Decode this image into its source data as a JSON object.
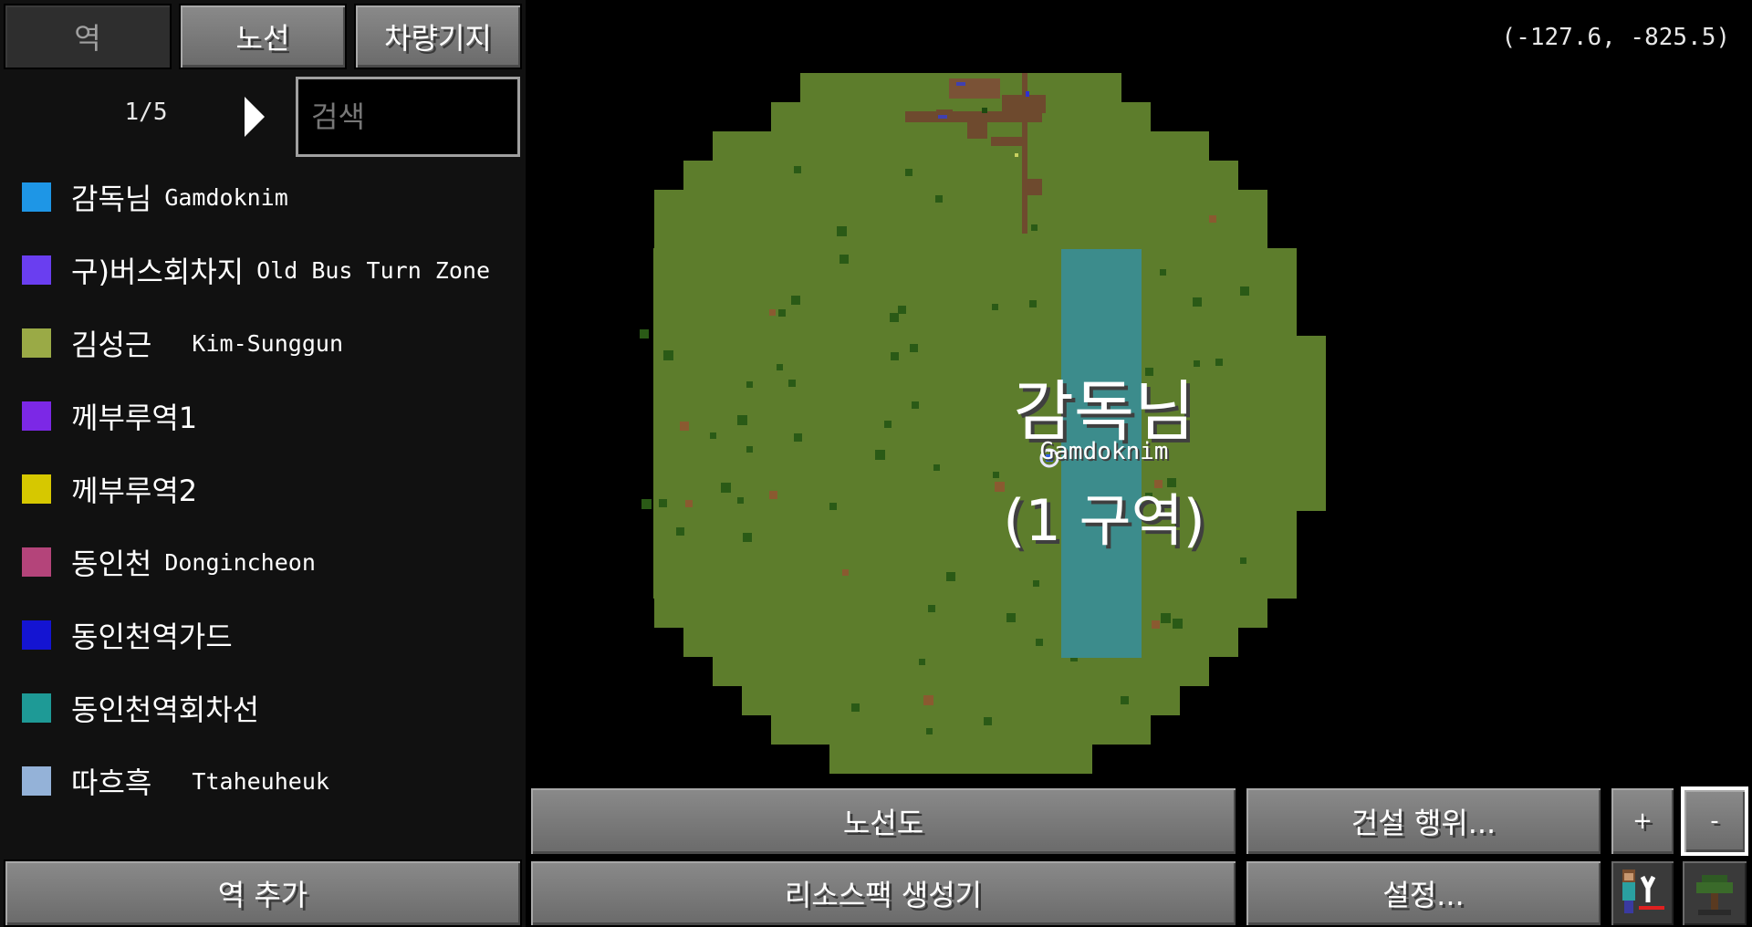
{
  "tabs": [
    {
      "label": "역",
      "active": true
    },
    {
      "label": "노선",
      "active": false
    },
    {
      "label": "차량기지",
      "active": false
    }
  ],
  "pager": {
    "text": "1/5"
  },
  "search": {
    "placeholder": "검색"
  },
  "stations": [
    {
      "ko": "감독님",
      "en": "Gamdoknim",
      "color": "#1e96e6"
    },
    {
      "ko": "구)버스회차지",
      "en": "Old Bus Turn Zone",
      "color": "#6a3ef0"
    },
    {
      "ko": "김성근",
      "en": "  Kim-Sunggun",
      "color": "#9aaa46"
    },
    {
      "ko": "께부루역1",
      "en": "",
      "color": "#7c28e6"
    },
    {
      "ko": "께부루역2",
      "en": "",
      "color": "#d6c800"
    },
    {
      "ko": "동인천",
      "en": "Dongincheon",
      "color": "#b4447a"
    },
    {
      "ko": "동인천역가드",
      "en": "",
      "color": "#1414d2"
    },
    {
      "ko": "동인천역회차선",
      "en": "",
      "color": "#1e9a96"
    },
    {
      "ko": "따흐흑",
      "en": "  Ttaheuheuk",
      "color": "#94b2d8"
    }
  ],
  "coords": "(-127.6, -825.5)",
  "map": {
    "station_name_ko": "감독님",
    "station_name_en": "Gamdoknim",
    "zone_label": "(1 구역)",
    "grass_color": "#5d7d2c",
    "station_area_color": "#3c8c8c"
  },
  "buttons": {
    "route_map": "노선도",
    "build_action": "건설 행위...",
    "zoom_in": "+",
    "zoom_out": "-",
    "add_station": "역 추가",
    "resource_pack": "리소스팩 생성기",
    "settings": "설정..."
  },
  "icons": {
    "player_icon": "player-icon",
    "tree_icon": "tree-icon"
  }
}
